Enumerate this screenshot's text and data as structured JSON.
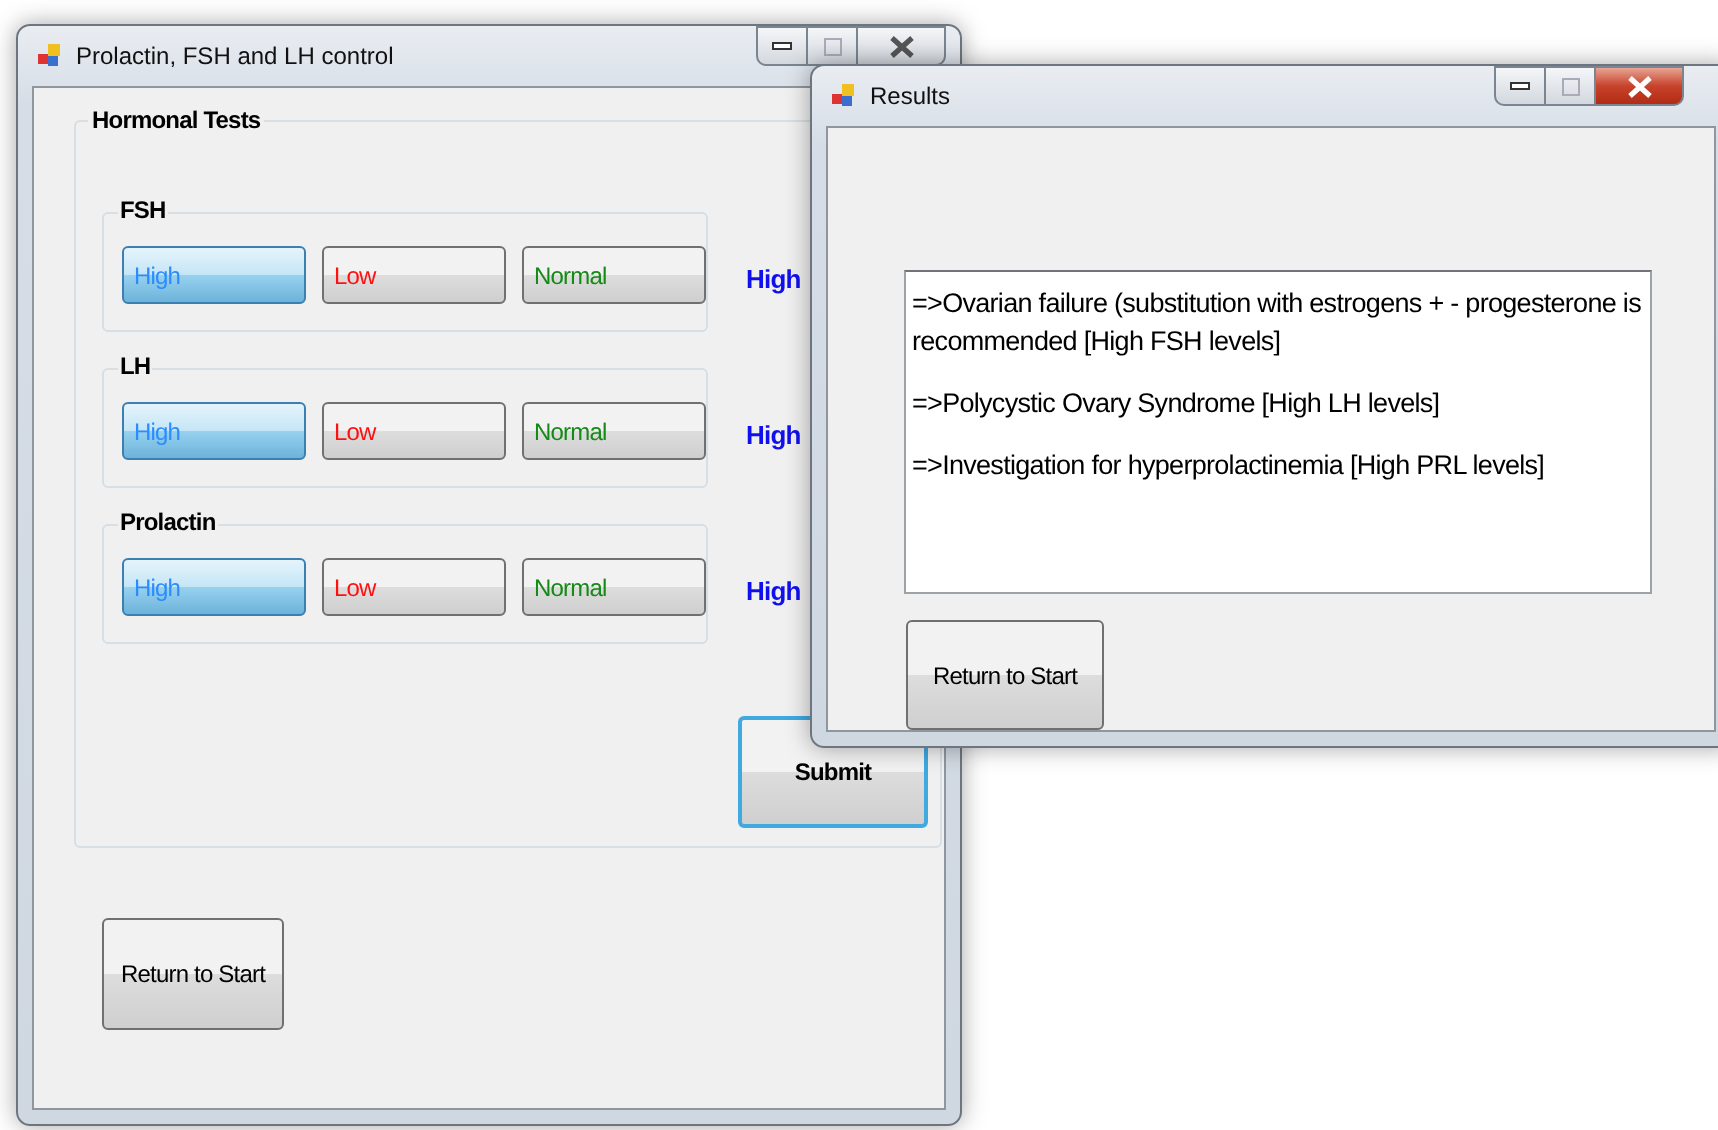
{
  "main_window": {
    "title": "Prolactin, FSH and LH control",
    "group_title": "Hormonal Tests",
    "tests": [
      {
        "name": "FSH",
        "result": "High",
        "options": [
          {
            "label": "High",
            "kind": "high",
            "selected": true
          },
          {
            "label": "Low",
            "kind": "low",
            "selected": false
          },
          {
            "label": "Normal",
            "kind": "normal",
            "selected": false
          }
        ]
      },
      {
        "name": "LH",
        "result": "High",
        "options": [
          {
            "label": "High",
            "kind": "high",
            "selected": true
          },
          {
            "label": "Low",
            "kind": "low",
            "selected": false
          },
          {
            "label": "Normal",
            "kind": "normal",
            "selected": false
          }
        ]
      },
      {
        "name": "Prolactin",
        "result": "High",
        "options": [
          {
            "label": "High",
            "kind": "high",
            "selected": true
          },
          {
            "label": "Low",
            "kind": "low",
            "selected": false
          },
          {
            "label": "Normal",
            "kind": "normal",
            "selected": false
          }
        ]
      }
    ],
    "submit_button": "Submit",
    "return_button": "Return to Start"
  },
  "results_window": {
    "title": "Results",
    "lines": [
      "=>Ovarian failure (substitution with estrogens + - progesterone is recommended  [High FSH levels]",
      "=>Polycystic Ovary Syndrome [High LH levels]",
      "=>Investigation for hyperprolactinemia [High PRL levels]"
    ],
    "return_button": "Return to Start"
  }
}
